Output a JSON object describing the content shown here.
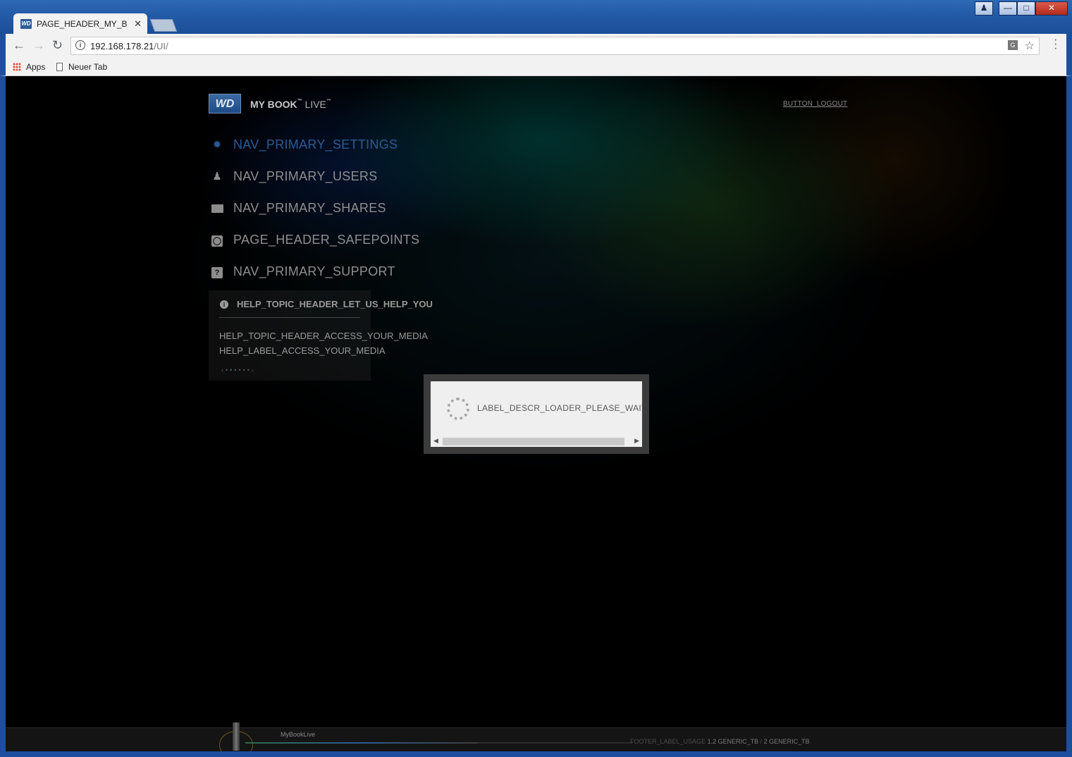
{
  "browser": {
    "tab_title": "PAGE_HEADER_MY_BOOK_LIVE",
    "tab_favicon_text": "WD",
    "address_host": "192.168.178.21",
    "address_path": "/UI/",
    "bookmarks": [
      "Apps",
      "Neuer Tab"
    ],
    "window_controls": [
      "user",
      "minimize",
      "maximize",
      "close"
    ]
  },
  "app": {
    "logo_text": "WD",
    "brand_main": "MY BOOK",
    "brand_live": "LIVE",
    "logout_label": "BUTTON_LOGOUT",
    "nav": [
      {
        "label": "NAV_PRIMARY_SETTINGS",
        "icon": "gear-icon",
        "active": true
      },
      {
        "label": "NAV_PRIMARY_USERS",
        "icon": "user-icon",
        "active": false
      },
      {
        "label": "NAV_PRIMARY_SHARES",
        "icon": "folder-icon",
        "active": false
      },
      {
        "label": "PAGE_HEADER_SAFEPOINTS",
        "icon": "camera-icon",
        "active": false
      },
      {
        "label": "NAV_PRIMARY_SUPPORT",
        "icon": "help-icon",
        "active": false
      }
    ],
    "help": {
      "title": "HELP_TOPIC_HEADER_LET_US_HELP_YOU",
      "topic": "HELP_TOPIC_HEADER_ACCESS_YOUR_MEDIA",
      "label": "HELP_LABEL_ACCESS_YOUR_MEDIA",
      "pager_total": 6,
      "pager_current": 2
    },
    "loader": {
      "text": "LABEL_DESCR_LOADER_PLEASE_WAIT"
    },
    "footer": {
      "device_name": "MyBookLive",
      "usage_label": "FOOTER_LABEL_USAGE",
      "usage_used": "1.2 GENERIC_TB",
      "usage_sep": "/",
      "usage_total": "2 GENERIC_TB",
      "usage_fraction": 0.6
    }
  },
  "colors": {
    "accent": "#2c5b93",
    "window_frame": "#1d4f9e"
  }
}
